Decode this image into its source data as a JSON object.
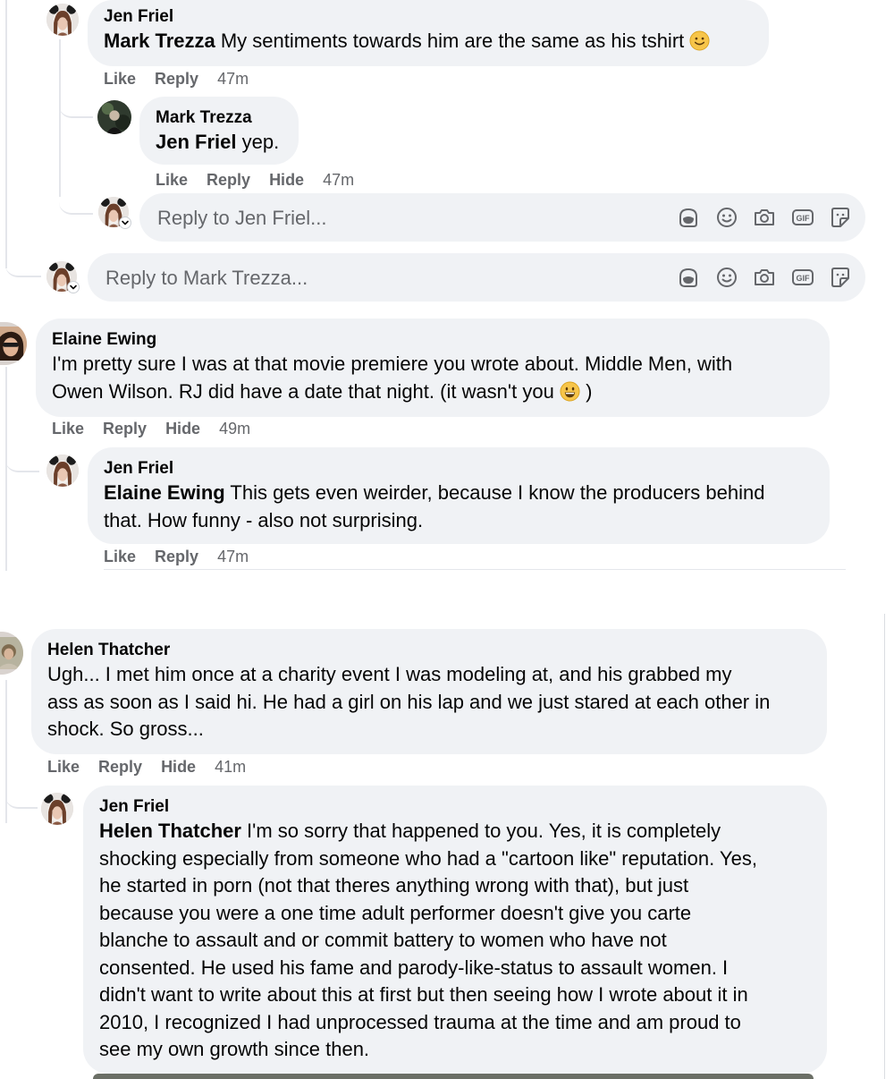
{
  "comments": [
    {
      "name": "Jen Friel",
      "mention": "Mark Trezza",
      "text": " My sentiments towards him are the same as his tshirt",
      "emoji": "slightly-smiling-face",
      "actions": [
        "Like",
        "Reply"
      ],
      "time": "47m"
    },
    {
      "name": "Mark Trezza",
      "mention": "Jen Friel",
      "text": " yep.",
      "actions": [
        "Like",
        "Reply",
        "Hide"
      ],
      "time": "47m"
    },
    {
      "name": "Elaine Ewing",
      "line1": "I'm pretty sure I was at that movie premiere you wrote about. Middle Men, with",
      "line2": "Owen Wilson. RJ did have a date that night. (it wasn't you",
      "line2_end": " )",
      "emoji": "grinning-face",
      "actions": [
        "Like",
        "Reply",
        "Hide"
      ],
      "time": "49m"
    },
    {
      "name": "Jen Friel",
      "mention": "Elaine Ewing",
      "line1": " This gets even weirder, because I know the producers behind",
      "line2": "that. How funny - also not surprising.",
      "actions": [
        "Like",
        "Reply"
      ],
      "time": "47m"
    },
    {
      "name": "Helen Thatcher",
      "lines": [
        "Ugh... I met him once at a charity event I was modeling at, and his grabbed my",
        "ass as soon as I said hi. He had a girl on his lap and we just stared at each other in",
        "shock. So gross..."
      ],
      "actions": [
        "Like",
        "Reply",
        "Hide"
      ],
      "time": "41m"
    },
    {
      "name": "Jen Friel",
      "mention": "Helen Thatcher",
      "first_line": " I'm so sorry that happened to you. Yes, it is completely",
      "lines": [
        "shocking especially from someone who had a \"cartoon like\" reputation. Yes,",
        "he started in porn (not that theres anything wrong with that), but just",
        "because you were a one time adult performer doesn't give you carte",
        "blanche to assault and or commit battery to women who have not",
        "consented. He used his fame and parody-like-status to assault women. I",
        "didn't want to write about this at first but then seeing how I wrote about it in",
        "2010, I recognized I had unprocessed trauma at the time and am proud to",
        "see my own growth since then."
      ]
    }
  ],
  "reply_boxes": [
    {
      "placeholder": "Reply to Jen Friel..."
    },
    {
      "placeholder": "Reply to Mark Trezza..."
    }
  ],
  "tool_icons": [
    "avatar-sticker-icon",
    "emoji-icon",
    "camera-icon",
    "gif-icon",
    "sticker-icon"
  ],
  "colors": {
    "bubble": "#f0f2f5",
    "secondary_text": "#65676b",
    "primary_text": "#050505",
    "thread_line": "#e4e6eb"
  }
}
